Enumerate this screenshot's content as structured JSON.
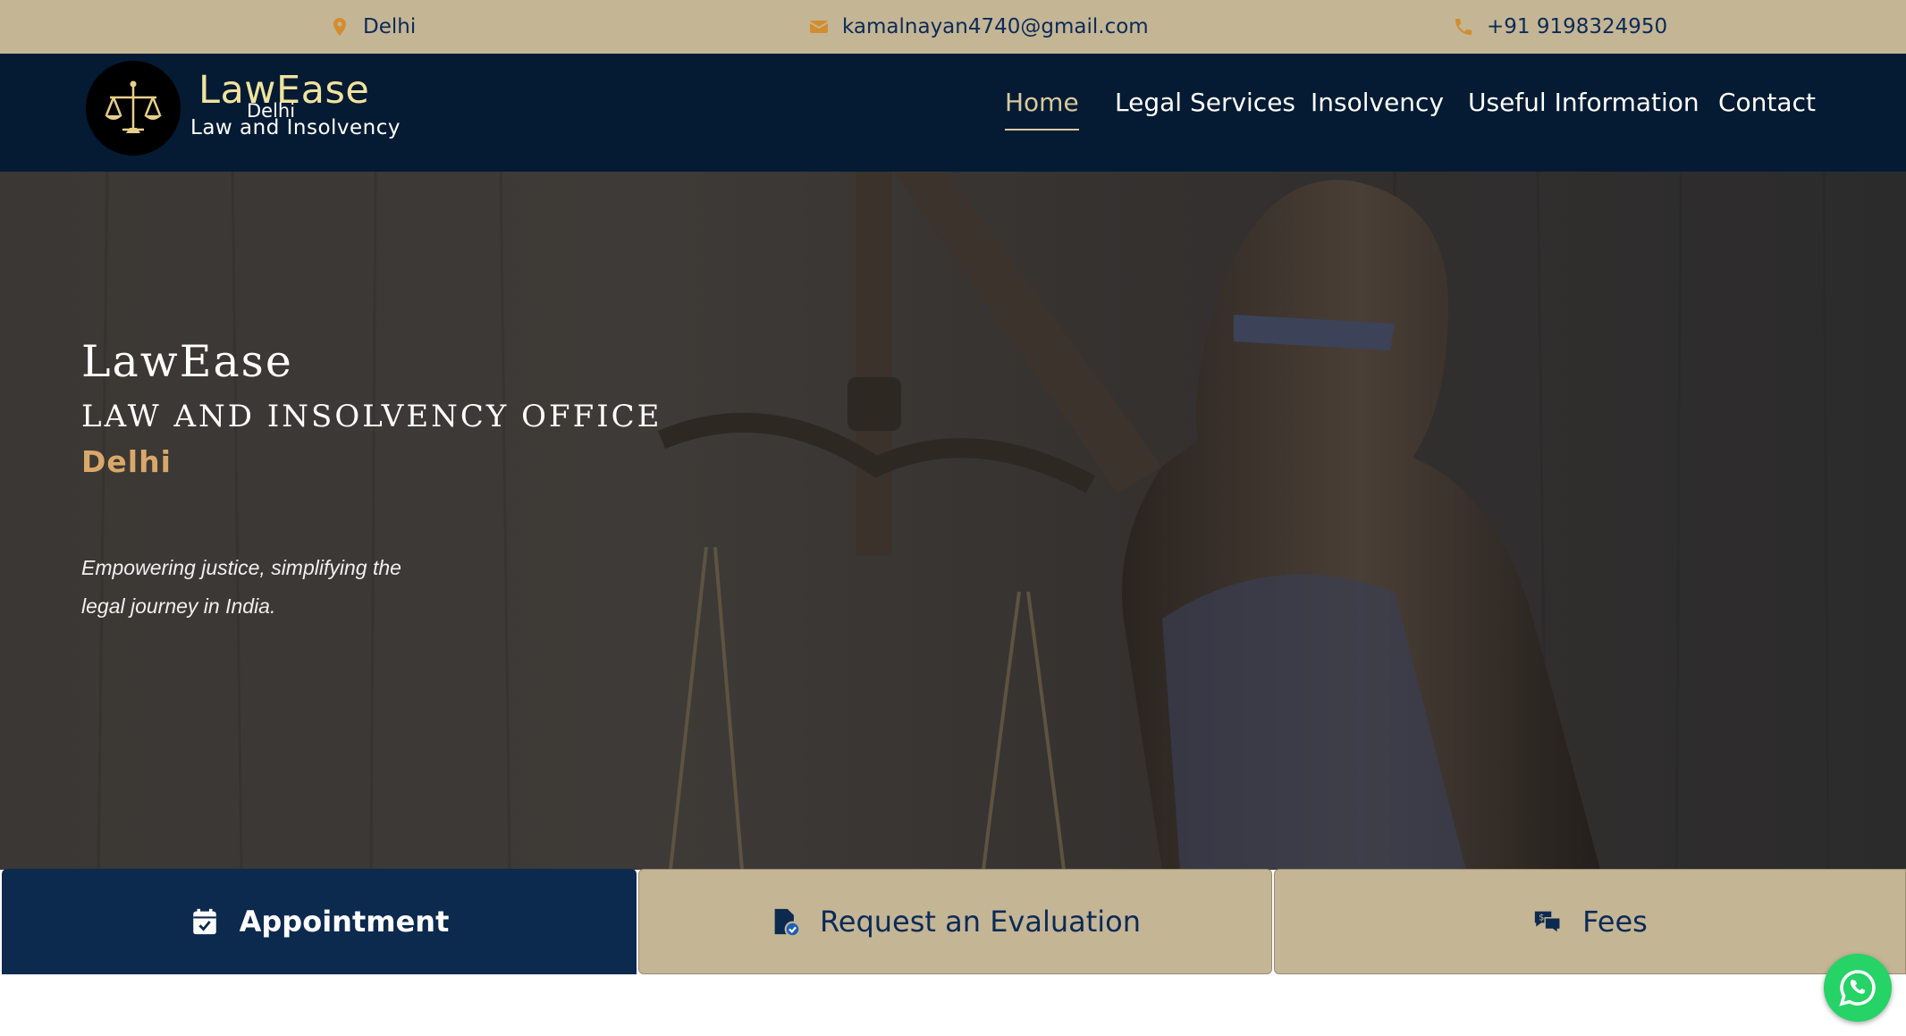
{
  "topbar": {
    "location": "Delhi",
    "email": "kamalnayan4740@gmail.com",
    "phone": "+91 9198324950"
  },
  "logo": {
    "name": "LawEase",
    "city": "Delhi",
    "subtitle": "Law and Insolvency"
  },
  "nav": {
    "items": [
      {
        "label": "Home",
        "active": true
      },
      {
        "label": "Legal Services",
        "active": false
      },
      {
        "label": "Insolvency",
        "active": false
      },
      {
        "label": "Useful Information",
        "active": false
      },
      {
        "label": "Contact",
        "active": false
      }
    ]
  },
  "hero": {
    "title": "LawEase",
    "office": "LAW AND INSOLVENCY OFFICE",
    "city": "Delhi",
    "tagline": "Empowering justice, simplifying the legal journey in India."
  },
  "actions": {
    "appointment": "Appointment",
    "evaluation": "Request an Evaluation",
    "fees": "Fees"
  },
  "colors": {
    "beige": "#c4b595",
    "navy": "#041b33",
    "accent_gold": "#d9a869",
    "icon_orange": "#d38d2f",
    "whatsapp": "#25d366"
  },
  "icons": [
    "location-pin-icon",
    "envelope-icon",
    "phone-icon",
    "scales-of-justice-icon",
    "calendar-check-icon",
    "file-check-icon",
    "fee-chat-icon",
    "whatsapp-icon"
  ]
}
